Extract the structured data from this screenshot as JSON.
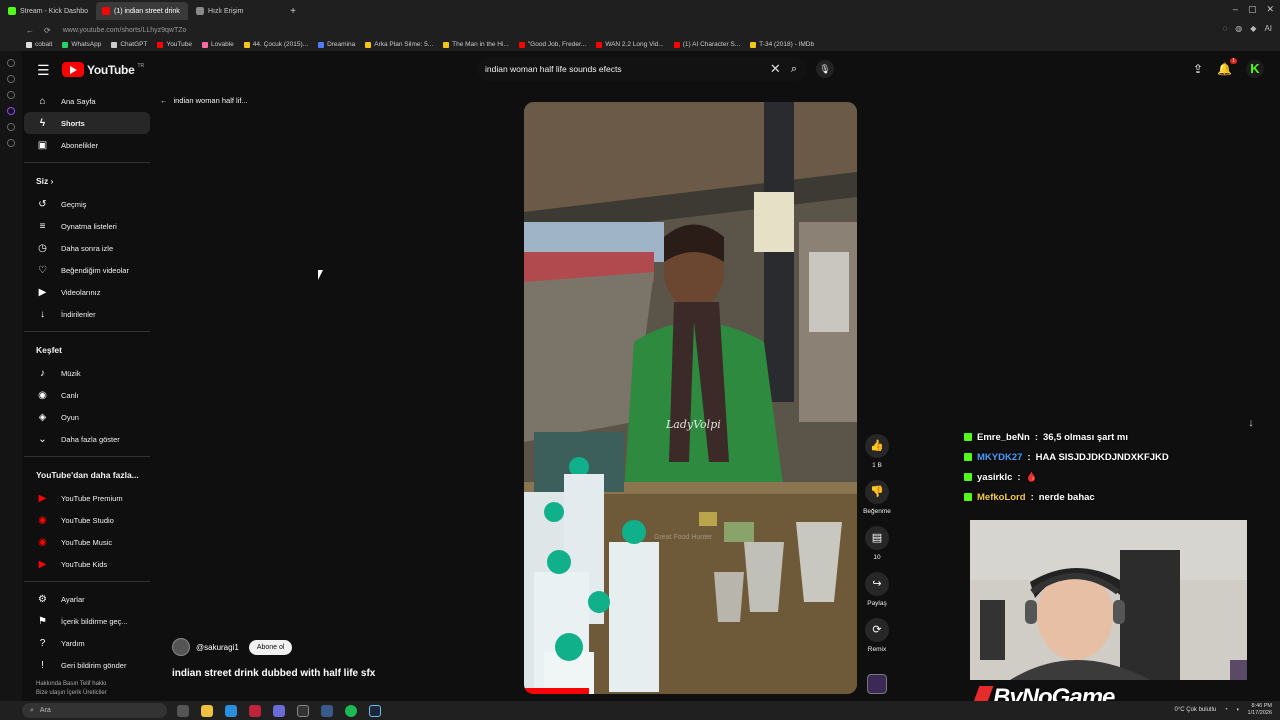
{
  "browser": {
    "tabs": [
      {
        "label": "Stream - Kick Dashbo",
        "color": "#53fc18",
        "active": false
      },
      {
        "label": "(1) indian street drink",
        "color": "#ff0000",
        "active": true
      },
      {
        "label": "Hızlı Erişim",
        "color": "#888888",
        "active": false
      }
    ],
    "url": "www.youtube.com/shorts/LLhyz9qwTZo",
    "bookmarks": [
      {
        "label": "cobalt",
        "color": "#dddddd"
      },
      {
        "label": "WhatsApp",
        "color": "#25d366"
      },
      {
        "label": "ChatGPT",
        "color": "#cccccc"
      },
      {
        "label": "YouTube",
        "color": "#ff0000"
      },
      {
        "label": "Lovable",
        "color": "#ff6ba0"
      },
      {
        "label": "44. Çocuk (2015)...",
        "color": "#f5c518"
      },
      {
        "label": "Dreamina",
        "color": "#4d7cff"
      },
      {
        "label": "Arka Plan Silme: 5...",
        "color": "#f5c518"
      },
      {
        "label": "The Man in the Hi...",
        "color": "#f5c518"
      },
      {
        "label": "\"Good Job, Freder...",
        "color": "#ff0000"
      },
      {
        "label": "WAN 2.2 Long Vid...",
        "color": "#ff0000"
      },
      {
        "label": "(1) AI Character S...",
        "color": "#ff0000"
      },
      {
        "label": "T-34 (2018) - IMDb",
        "color": "#f5c518"
      }
    ],
    "right_icon_text": "AI"
  },
  "youtube": {
    "logo_text": "YouTube",
    "logo_country": "TR",
    "search_query": "indian woman half life sounds efects",
    "notification_count": "1",
    "back_label": "indian woman half lif..."
  },
  "sidebar": {
    "main": [
      {
        "label": "Ana Sayfa",
        "icon": "⌂",
        "name": "home",
        "active": false
      },
      {
        "label": "Shorts",
        "icon": "ϟ",
        "name": "shorts",
        "active": true
      },
      {
        "label": "Abonelikler",
        "icon": "▣",
        "name": "subscriptions",
        "active": false
      }
    ],
    "you_title": "Siz",
    "you": [
      {
        "label": "Geçmiş",
        "icon": "↺",
        "name": "history"
      },
      {
        "label": "Oynatma listeleri",
        "icon": "≡",
        "name": "playlists"
      },
      {
        "label": "Daha sonra izle",
        "icon": "◷",
        "name": "watch-later"
      },
      {
        "label": "Beğendiğim videolar",
        "icon": "♡",
        "name": "liked-videos"
      },
      {
        "label": "Videolarınız",
        "icon": "▶",
        "name": "your-videos"
      },
      {
        "label": "İndirilenler",
        "icon": "↓",
        "name": "downloads"
      }
    ],
    "explore_title": "Keşfet",
    "explore": [
      {
        "label": "Müzik",
        "icon": "♪",
        "name": "music"
      },
      {
        "label": "Canlı",
        "icon": "◉",
        "name": "live"
      },
      {
        "label": "Oyun",
        "icon": "◈",
        "name": "gaming"
      },
      {
        "label": "Daha fazla göster",
        "icon": "⌄",
        "name": "show-more"
      }
    ],
    "more_title": "YouTube'dan daha fazla...",
    "more": [
      {
        "label": "YouTube Premium",
        "icon": "▶",
        "name": "youtube-premium"
      },
      {
        "label": "YouTube Studio",
        "icon": "◉",
        "name": "youtube-studio"
      },
      {
        "label": "YouTube Music",
        "icon": "◉",
        "name": "youtube-music"
      },
      {
        "label": "YouTube Kids",
        "icon": "▶",
        "name": "youtube-kids"
      }
    ],
    "settings": [
      {
        "label": "Ayarlar",
        "icon": "⚙",
        "name": "settings"
      },
      {
        "label": "İçerik bildirme geç...",
        "icon": "⚑",
        "name": "report-history"
      },
      {
        "label": "Yardım",
        "icon": "?",
        "name": "help"
      },
      {
        "label": "Geri bildirim gönder",
        "icon": "!",
        "name": "send-feedback"
      }
    ],
    "footer_line1": "Hakkında  Basın  Telif hakkı",
    "footer_line2": "Bize ulaşın  İçerik Üreticiler"
  },
  "short": {
    "channel": "@sakuragi1",
    "subscribe_label": "Abone ol",
    "title": "indian street drink dubbed with half life sfx",
    "watermark_1": "LadyVolpi",
    "watermark_2": "Great Food Hunter",
    "actions": [
      {
        "label": "1 B",
        "icon": "👍",
        "name": "like"
      },
      {
        "label": "Beğenme",
        "icon": "👎",
        "name": "dislike"
      },
      {
        "label": "10",
        "icon": "▤",
        "name": "comments"
      },
      {
        "label": "Paylaş",
        "icon": "↪",
        "name": "share"
      },
      {
        "label": "Remix",
        "icon": "⟳",
        "name": "remix"
      }
    ]
  },
  "stream_overlay": {
    "chat": [
      {
        "user": "Emre_beNn",
        "color": "#ffffff",
        "message": "36,5 olması şart mı"
      },
      {
        "user": "MKYDK27",
        "color": "#4a9eff",
        "message": "HAA SISJDJDKDJNDXKFJKD"
      },
      {
        "user": "yasirklc",
        "color": "#ffffff",
        "message": "🩸"
      },
      {
        "user": "MefkoLord",
        "color": "#f2c94c",
        "message": "nerde bahac"
      }
    ],
    "brand": "ByNoGame"
  },
  "taskbar": {
    "search_placeholder": "Ara",
    "weather": "0°C  Çok bulutlu",
    "time": "8:46 PM",
    "date": "1/17/2026"
  }
}
